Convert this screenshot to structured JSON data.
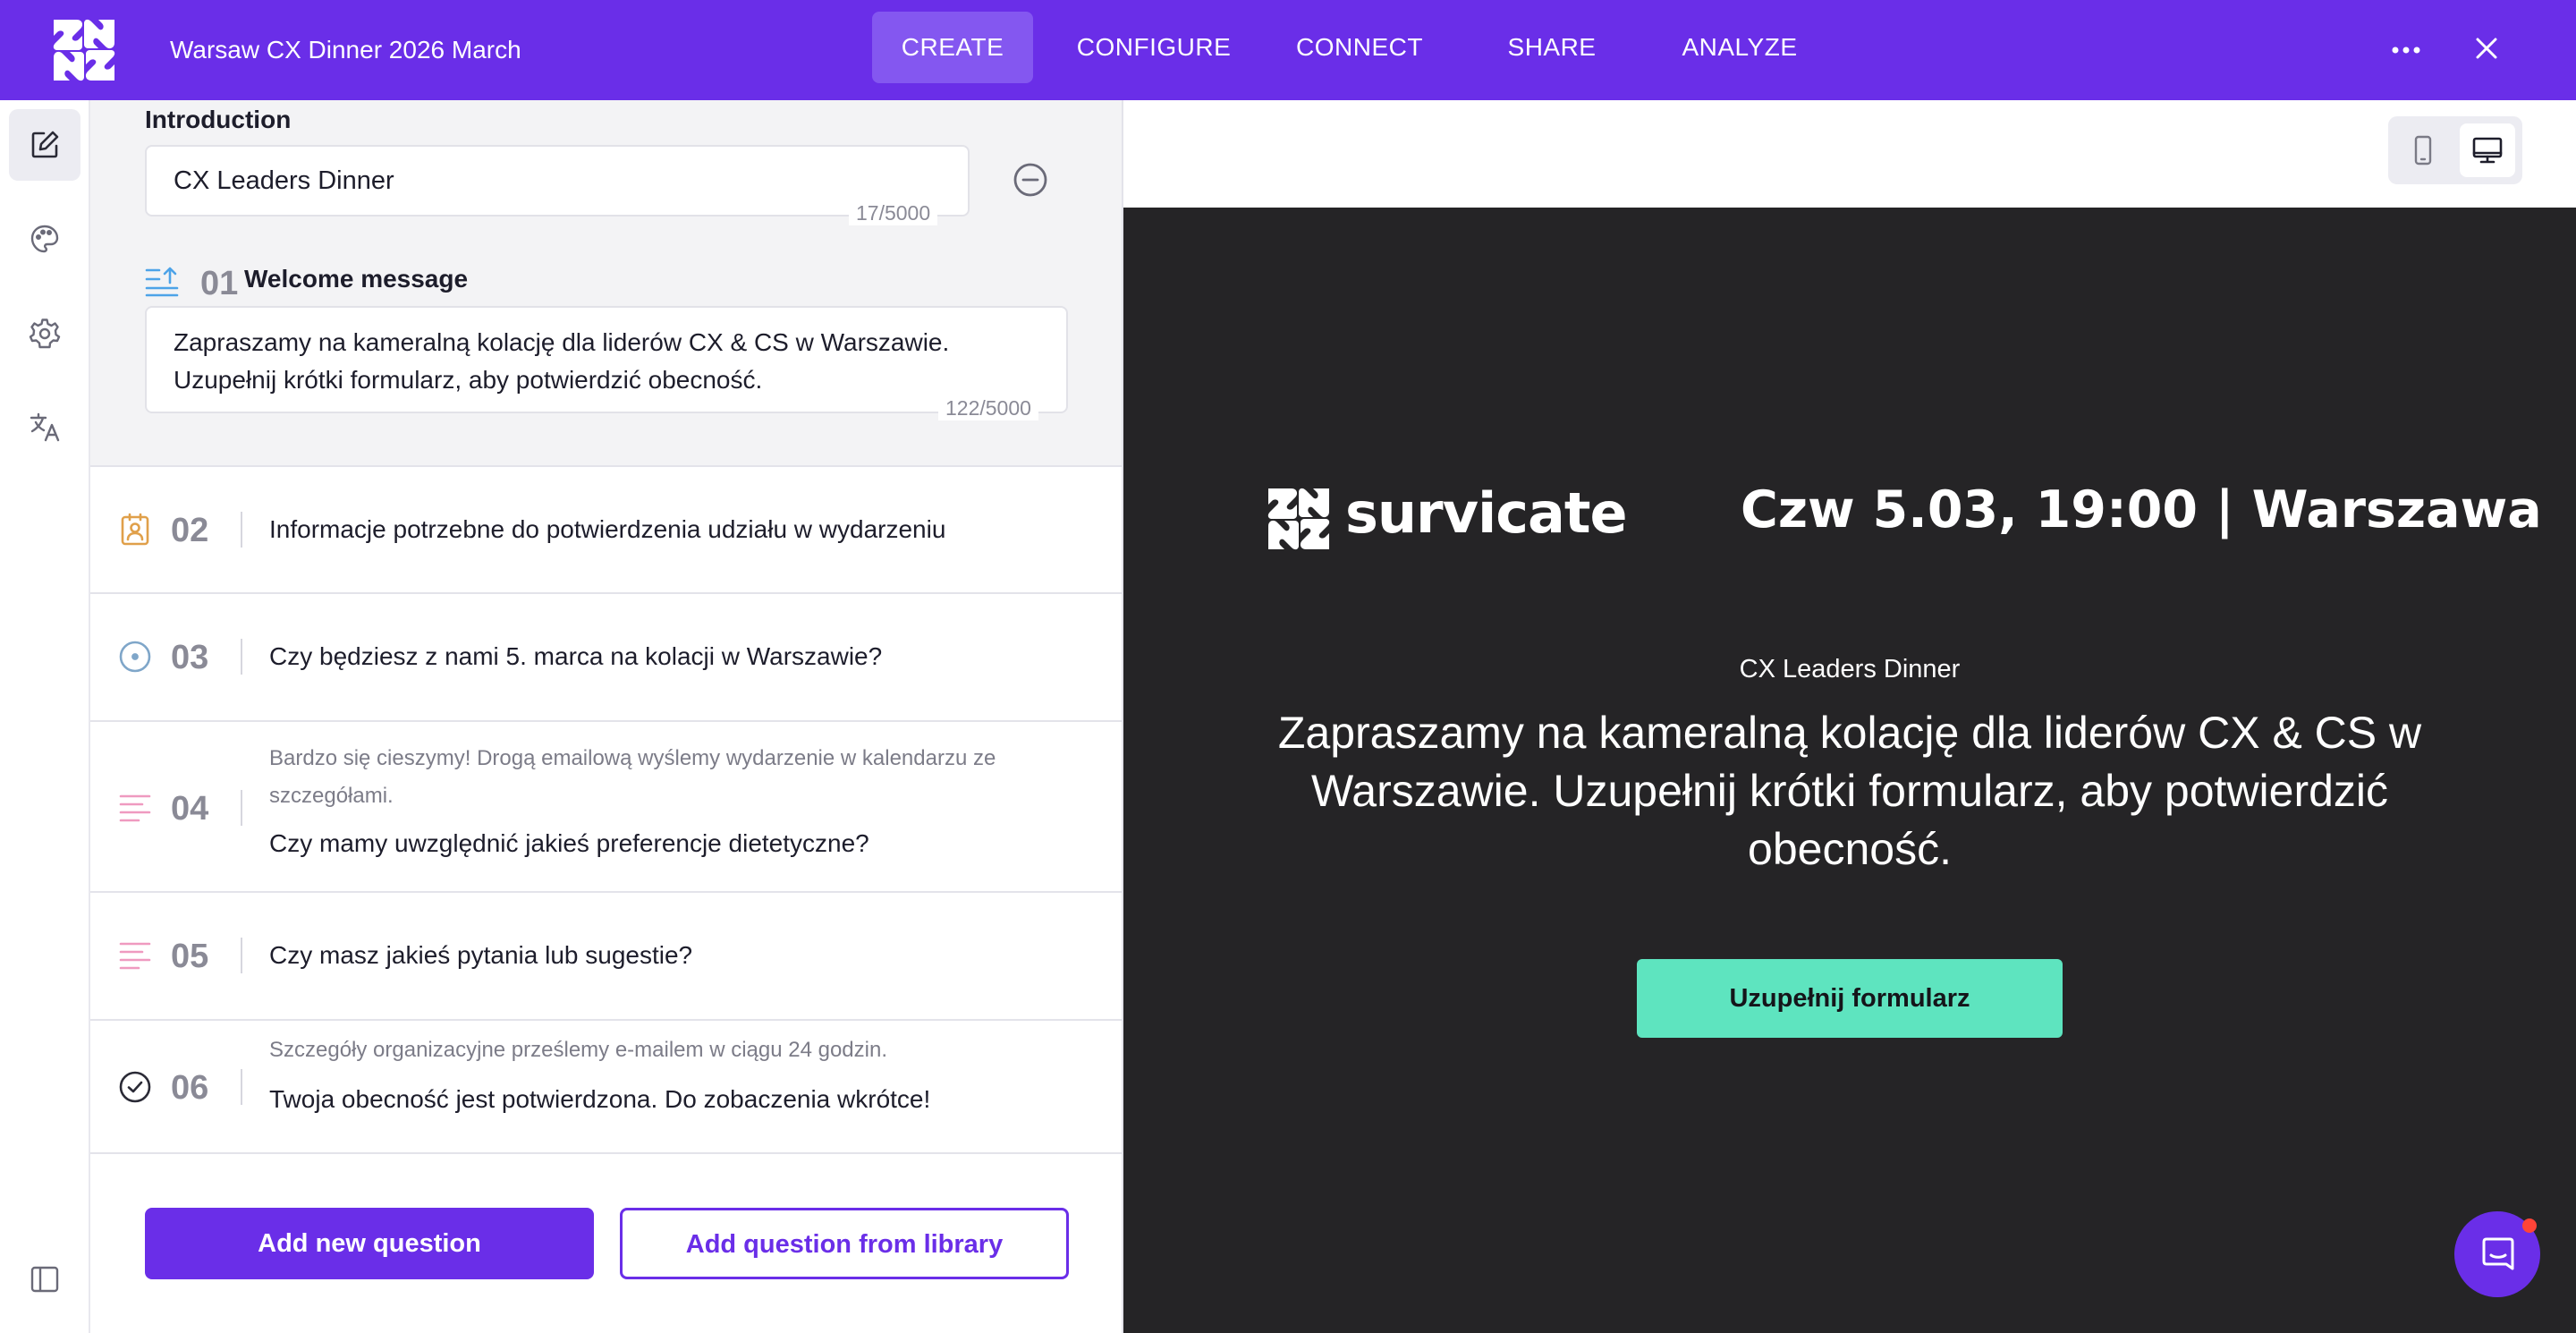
{
  "app": {
    "survey_title": "Warsaw CX Dinner 2026 March",
    "nav": [
      {
        "label": "CREATE",
        "active": true
      },
      {
        "label": "CONFIGURE",
        "active": false
      },
      {
        "label": "CONNECT",
        "active": false
      },
      {
        "label": "SHARE",
        "active": false
      },
      {
        "label": "ANALYZE",
        "active": false
      }
    ],
    "icons": {
      "more": "more-horizontal-icon",
      "close": "close-icon"
    },
    "accent_color": "#6a2ee8"
  },
  "sidebar": {
    "items": [
      {
        "name": "edit-icon",
        "active": true
      },
      {
        "name": "palette-icon",
        "active": false
      },
      {
        "name": "gear-icon",
        "active": false
      },
      {
        "name": "translate-icon",
        "active": false
      },
      {
        "name": "panel-toggle-icon",
        "active": false
      }
    ]
  },
  "editor": {
    "intro": {
      "label": "Introduction",
      "value": "CX Leaders Dinner",
      "counter": "17/5000"
    },
    "welcome": {
      "number": "01",
      "title": "Welcome message",
      "value": "Zapraszamy na kameralną kolację dla liderów CX & CS w Warszawie. Uzupełnij krótki formularz, aby potwierdzić obecność.",
      "counter": "122/5000"
    },
    "questions": [
      {
        "number": "02",
        "icon": "contact-form-icon",
        "description": "",
        "text": "Informacje potrzebne do potwierdzenia udziału w wydarzeniu"
      },
      {
        "number": "03",
        "icon": "single-choice-icon",
        "description": "",
        "text": "Czy będziesz z nami 5. marca na kolacji w Warszawie?"
      },
      {
        "number": "04",
        "icon": "text-answer-icon",
        "description": "Bardzo się cieszymy! Drogą emailową wyślemy wydarzenie w kalendarzu ze szczegółami.",
        "text": "Czy mamy uwzględnić jakieś preferencje dietetyczne?"
      },
      {
        "number": "05",
        "icon": "text-answer-icon",
        "description": "",
        "text": "Czy masz jakieś pytania lub sugestie?"
      },
      {
        "number": "06",
        "icon": "check-circle-icon",
        "description": "Szczegóły organizacyjne prześlemy e-mailem w ciągu 24 godzin.",
        "text": "Twoja obecność jest potwierdzona. Do zobaczenia wkrótce!"
      }
    ],
    "add_new_label": "Add new question",
    "add_library_label": "Add question from library"
  },
  "preview": {
    "device_options": [
      "mobile-icon",
      "desktop-icon"
    ],
    "selected_device": "desktop",
    "brand_name": "survicate",
    "event_date": "Czw 5.03, 19:00 | Warszawa",
    "intro": "CX Leaders Dinner",
    "message": "Zapraszamy na kameralną kolację dla liderów CX & CS w Warszawie. Uzupełnij krótki formularz, aby potwierdzić obecność.",
    "cta_label": "Uzupełnij formularz",
    "background_color": "#252426",
    "cta_color": "#5ee4bf"
  },
  "support": {
    "chat_icon": "chat-icon",
    "notification_color": "#ff4438"
  }
}
